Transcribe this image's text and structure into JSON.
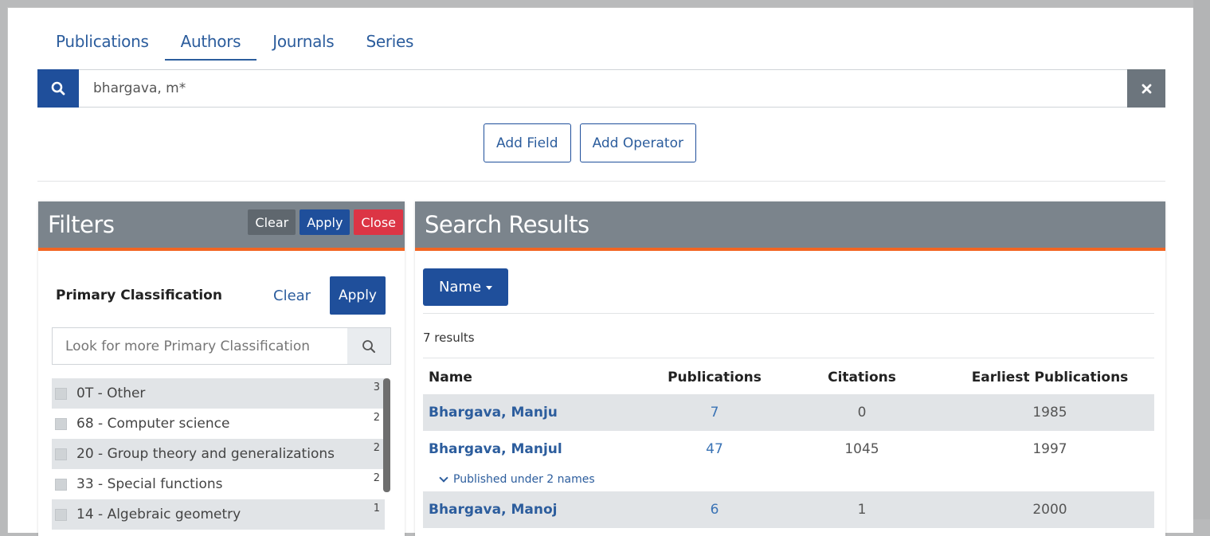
{
  "tabs": [
    {
      "label": "Publications",
      "active": false
    },
    {
      "label": "Authors",
      "active": true
    },
    {
      "label": "Journals",
      "active": false
    },
    {
      "label": "Series",
      "active": false
    }
  ],
  "search": {
    "value": "bhargava, m*",
    "clear_icon": "close-icon"
  },
  "builder": {
    "add_field": "Add Field",
    "add_operator": "Add Operator"
  },
  "filters": {
    "title": "Filters",
    "clear": "Clear",
    "apply": "Apply",
    "close": "Close",
    "primary": {
      "title": "Primary Classification",
      "clear": "Clear",
      "apply": "Apply",
      "look_placeholder": "Look for more Primary Classification",
      "items": [
        {
          "label": "0T - Other",
          "count": "3"
        },
        {
          "label": "68 - Computer science",
          "count": "2"
        },
        {
          "label": "20 - Group theory and generalizations",
          "count": "2"
        },
        {
          "label": "33 - Special functions",
          "count": "2"
        },
        {
          "label": "14 - Algebraic geometry",
          "count": "1"
        }
      ]
    }
  },
  "results": {
    "title": "Search Results",
    "sort_label": "Name",
    "count_text": "7 results",
    "headers": {
      "name": "Name",
      "publications": "Publications",
      "citations": "Citations",
      "earliest": "Earliest Publications"
    },
    "rows": [
      {
        "name": "Bhargava, Manju",
        "publications": "7",
        "citations": "0",
        "earliest": "1985"
      },
      {
        "name": "Bhargava, Manjul",
        "publications": "47",
        "citations": "1045",
        "earliest": "1997",
        "note": "Published under 2 names"
      },
      {
        "name": "Bhargava, Manoj",
        "publications": "6",
        "citations": "1",
        "earliest": "2000"
      }
    ]
  },
  "colors": {
    "primary": "#1f4f9b",
    "accent": "#f26522",
    "header": "#7b848c",
    "danger": "#dc3545"
  }
}
